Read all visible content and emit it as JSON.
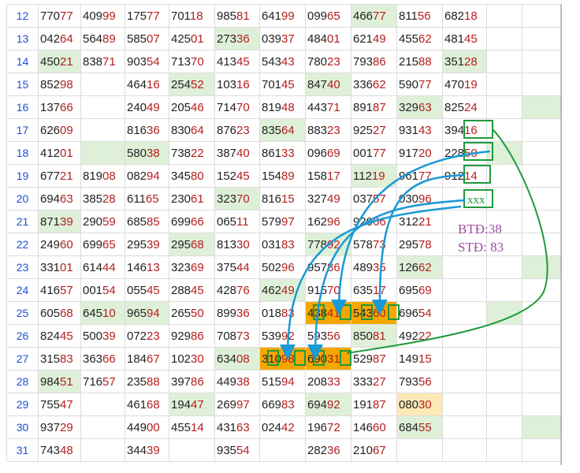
{
  "rows": [
    {
      "n": "12",
      "cells": [
        "77077",
        "40999",
        "17577",
        "70118",
        "98581",
        "64199",
        "09965",
        "46677",
        "81156",
        "68218",
        "",
        ""
      ],
      "shade": [
        "",
        "",
        "",
        "",
        "",
        "",
        "",
        "g",
        "",
        "",
        "",
        ""
      ]
    },
    {
      "n": "13",
      "cells": [
        "04264",
        "56489",
        "58507",
        "42501",
        "27336",
        "03937",
        "48401",
        "62149",
        "45562",
        "48145",
        "",
        ""
      ],
      "shade": [
        "",
        "",
        "",
        "",
        "g",
        "",
        "",
        "",
        "",
        "",
        "",
        ""
      ]
    },
    {
      "n": "14",
      "cells": [
        "45021",
        "83871",
        "90354",
        "71370",
        "41345",
        "54343",
        "78023",
        "79386",
        "21588",
        "35128",
        "",
        ""
      ],
      "shade": [
        "g",
        "",
        "",
        "",
        "",
        "",
        "",
        "",
        "",
        "g",
        "",
        ""
      ]
    },
    {
      "n": "15",
      "cells": [
        "85298",
        "",
        "46416",
        "25452",
        "10316",
        "70145",
        "84740",
        "33662",
        "59077",
        "47019",
        "",
        ""
      ],
      "shade": [
        "",
        "",
        "",
        "g",
        "",
        "",
        "g",
        "",
        "",
        "",
        "",
        ""
      ]
    },
    {
      "n": "16",
      "cells": [
        "13766",
        "",
        "24049",
        "20546",
        "71470",
        "81948",
        "44371",
        "89187",
        "32963",
        "82524",
        "",
        ""
      ],
      "shade": [
        "",
        "",
        "",
        "",
        "",
        "",
        "",
        "",
        "g",
        "",
        "",
        "g"
      ]
    },
    {
      "n": "17",
      "cells": [
        "62609",
        "",
        "81636",
        "83064",
        "87623",
        "83564",
        "88323",
        "92527",
        "93143",
        "39416",
        "",
        ""
      ],
      "shade": [
        "",
        "",
        "",
        "",
        "",
        "g",
        "",
        "",
        "",
        "",
        "",
        ""
      ]
    },
    {
      "n": "18",
      "cells": [
        "41201",
        "",
        "58038",
        "73822",
        "38740",
        "86133",
        "09669",
        "00177",
        "91720",
        "22850",
        "",
        ""
      ],
      "shade": [
        "",
        "g",
        "g",
        "",
        "",
        "",
        "",
        "",
        "",
        "",
        "g",
        ""
      ]
    },
    {
      "n": "19",
      "cells": [
        "67721",
        "81908",
        "08294",
        "34580",
        "15245",
        "15489",
        "15817",
        "11219",
        "96177",
        "91214",
        "",
        ""
      ],
      "shade": [
        "",
        "",
        "",
        "",
        "",
        "",
        "",
        "g",
        "",
        "",
        "",
        ""
      ]
    },
    {
      "n": "20",
      "cells": [
        "69463",
        "38528",
        "61165",
        "23061",
        "32370",
        "81615",
        "32749",
        "03757",
        "03096",
        "",
        "",
        ""
      ],
      "shade": [
        "",
        "",
        "",
        "",
        "g",
        "",
        "",
        "",
        "",
        "",
        "",
        ""
      ]
    },
    {
      "n": "21",
      "cells": [
        "87139",
        "29059",
        "68585",
        "69966",
        "06511",
        "57997",
        "16296",
        "92066",
        "31221",
        "",
        "",
        ""
      ],
      "shade": [
        "g",
        "",
        "",
        "",
        "",
        "",
        "",
        "",
        "",
        "",
        "",
        ""
      ]
    },
    {
      "n": "22",
      "cells": [
        "24960",
        "69965",
        "29539",
        "29568",
        "81330",
        "03183",
        "77892",
        "57873",
        "29578",
        "",
        "",
        ""
      ],
      "shade": [
        "",
        "",
        "",
        "g",
        "",
        "",
        "g",
        "",
        "",
        "",
        "",
        ""
      ]
    },
    {
      "n": "23",
      "cells": [
        "33101",
        "61444",
        "14613",
        "32369",
        "37544",
        "50296",
        "95786",
        "48935",
        "12662",
        "",
        "",
        ""
      ],
      "shade": [
        "",
        "",
        "",
        "",
        "",
        "",
        "",
        "",
        "g",
        "",
        "",
        "g"
      ]
    },
    {
      "n": "24",
      "cells": [
        "41657",
        "00154",
        "05545",
        "28845",
        "42876",
        "46249",
        "91570",
        "63517",
        "69569",
        "",
        "",
        ""
      ],
      "shade": [
        "",
        "",
        "",
        "",
        "",
        "g",
        "",
        "",
        "",
        "",
        "",
        ""
      ]
    },
    {
      "n": "25",
      "cells": [
        "60568",
        "64510",
        "96594",
        "26550",
        "89936",
        "01883",
        "43841",
        "54360",
        "69654",
        "",
        "",
        ""
      ],
      "shade": [
        "",
        "g",
        "g",
        "",
        "",
        "",
        "o",
        "o",
        "",
        "",
        "g",
        ""
      ]
    },
    {
      "n": "26",
      "cells": [
        "82445",
        "50039",
        "07223",
        "92986",
        "70873",
        "53992",
        "59356",
        "85081",
        "49222",
        "",
        "",
        ""
      ],
      "shade": [
        "",
        "",
        "",
        "",
        "",
        "",
        "",
        "g",
        "",
        "",
        "",
        ""
      ]
    },
    {
      "n": "27",
      "cells": [
        "31583",
        "36366",
        "18467",
        "10230",
        "63408",
        "31098",
        "69031",
        "52987",
        "14915",
        "",
        "",
        ""
      ],
      "shade": [
        "",
        "",
        "",
        "",
        "g",
        "o",
        "o",
        "",
        "",
        "",
        "",
        ""
      ]
    },
    {
      "n": "28",
      "cells": [
        "98451",
        "71657",
        "23588",
        "39786",
        "44938",
        "51594",
        "20833",
        "33327",
        "79356",
        "",
        "",
        ""
      ],
      "shade": [
        "g",
        "",
        "",
        "",
        "",
        "",
        "",
        "",
        "",
        "",
        "",
        ""
      ]
    },
    {
      "n": "29",
      "cells": [
        "75547",
        "",
        "46168",
        "19447",
        "26997",
        "66983",
        "69492",
        "19187",
        "08030",
        "",
        "",
        ""
      ],
      "shade": [
        "",
        "",
        "",
        "g",
        "",
        "",
        "g",
        "",
        "y",
        "",
        "",
        ""
      ]
    },
    {
      "n": "30",
      "cells": [
        "93729",
        "",
        "44900",
        "45514",
        "43163",
        "02442",
        "19672",
        "14660",
        "68455",
        "",
        "",
        ""
      ],
      "shade": [
        "",
        "",
        "",
        "",
        "",
        "",
        "",
        "",
        "g",
        "",
        "",
        "g"
      ]
    },
    {
      "n": "31",
      "cells": [
        "74348",
        "",
        "34439",
        "",
        "93554",
        "",
        "28236",
        "21067",
        "",
        "",
        "",
        ""
      ],
      "shade": [
        "",
        "",
        "",
        "",
        "",
        "",
        "",
        "",
        "",
        "",
        "",
        ""
      ]
    }
  ],
  "annotations": {
    "xxx": "xxx",
    "btd": "BTĐ:38",
    "std": "STĐ: 83"
  },
  "colors": {
    "green_box": "#1e9a3c",
    "blue_arrow": "#1a9ad6",
    "annotation_text": "#a04ca0"
  }
}
